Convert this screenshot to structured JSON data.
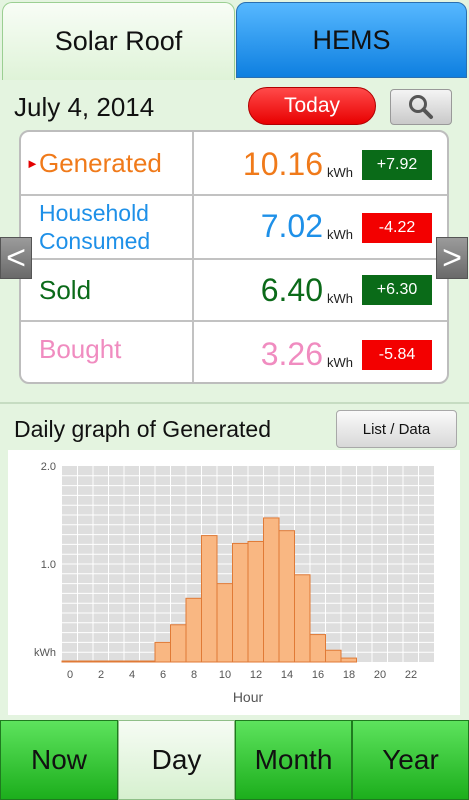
{
  "tabs": {
    "solar_roof": "Solar Roof",
    "hems": "HEMS"
  },
  "date": "July 4, 2014",
  "today_label": "Today",
  "nav": {
    "prev": "<",
    "next": ">"
  },
  "summary": [
    {
      "label": "Generated",
      "value": "10.16",
      "unit": "kWh",
      "delta": "+7.92",
      "color": "#f07a1a",
      "delta_sign": "pos"
    },
    {
      "label": "Household Consumed",
      "value": "7.02",
      "unit": "kWh",
      "delta": "-4.22",
      "color": "#1e90e8",
      "delta_sign": "neg"
    },
    {
      "label": "Sold",
      "value": "6.40",
      "unit": "kWh",
      "delta": "+6.30",
      "color": "#0b6a19",
      "delta_sign": "pos"
    },
    {
      "label": "Bought",
      "value": "3.26",
      "unit": "kWh",
      "delta": "-5.84",
      "color": "#f08cc0",
      "delta_sign": "neg"
    }
  ],
  "graph": {
    "title": "Daily graph of Generated",
    "list_button": "List / Data"
  },
  "chart_data": {
    "type": "bar",
    "xlabel": "Hour",
    "ylabel": "kWh",
    "ylim": [
      0,
      2.0
    ],
    "xlim": [
      0,
      24
    ],
    "yticks": [
      "2.0",
      "1.0"
    ],
    "xticks": [
      "0",
      "2",
      "4",
      "6",
      "8",
      "10",
      "12",
      "14",
      "16",
      "18",
      "20",
      "22"
    ],
    "categories": [
      0,
      1,
      2,
      3,
      4,
      5,
      6,
      7,
      8,
      9,
      10,
      11,
      12,
      13,
      14,
      15,
      16,
      17,
      18,
      19,
      20,
      21,
      22,
      23
    ],
    "values": [
      0.01,
      0.01,
      0.01,
      0.01,
      0.01,
      0.01,
      0.2,
      0.38,
      0.65,
      1.29,
      0.8,
      1.21,
      1.23,
      1.47,
      1.34,
      0.89,
      0.28,
      0.12,
      0.04,
      0,
      0,
      0,
      0,
      0
    ],
    "grid": true,
    "colors": {
      "bar_fill": "#f9b782",
      "bar_stroke": "#e07a36",
      "plot_bg": "#dedede"
    }
  },
  "bottom_tabs": [
    "Now",
    "Day",
    "Month",
    "Year"
  ],
  "selected_bottom_tab": "Day"
}
